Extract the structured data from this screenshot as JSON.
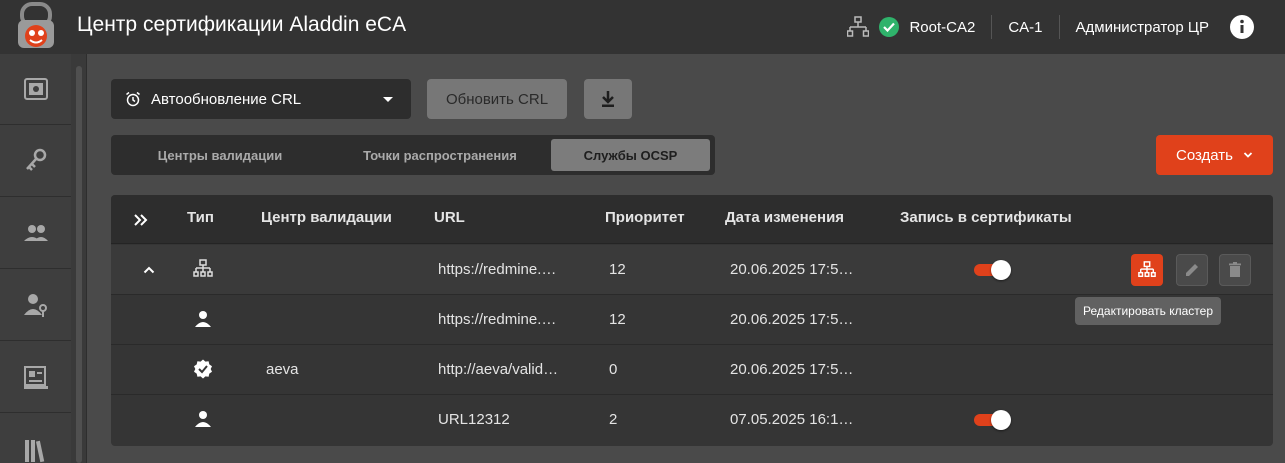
{
  "header": {
    "title": "Центр сертификации Aladdin eCA",
    "ca_name": "Root-CA2",
    "node": "CA-1",
    "user": "Администратор ЦР",
    "icons": [
      "logo-icon",
      "network-icon",
      "check-circle-icon",
      "info-icon"
    ]
  },
  "sidebar": {
    "items": [
      "dashboard-icon",
      "keys-icon",
      "users-icon",
      "user-key-icon",
      "certificate-icon",
      "library-icon"
    ]
  },
  "toolbar": {
    "select_label": "Автообновление CRL",
    "refresh_label": "Обновить CRL",
    "download_icon": "download-icon"
  },
  "tabs": [
    {
      "label": "Центры валидации",
      "active": false
    },
    {
      "label": "Точки распространения",
      "active": false
    },
    {
      "label": "Службы OCSP",
      "active": true
    }
  ],
  "create_label": "Создать",
  "table": {
    "columns": [
      "Тип",
      "Центр валидации",
      "URL",
      "Приоритет",
      "Дата изменения",
      "Запись в сертификаты"
    ],
    "rows": [
      {
        "type_icon": "cluster-icon",
        "center": "",
        "url": "https://redmine.…",
        "priority": "12",
        "date": "20.06.2025 17:5…",
        "write": true,
        "expanded": true
      },
      {
        "type_icon": "user-icon",
        "center": "",
        "url": "https://redmine.…",
        "priority": "12",
        "date": "20.06.2025 17:5…",
        "write": null
      },
      {
        "type_icon": "verified-icon",
        "center": "aeva",
        "url": "http://aeva/valid…",
        "priority": "0",
        "date": "20.06.2025 17:5…",
        "write": null
      },
      {
        "type_icon": "user-icon",
        "center": "",
        "url": "URL12312",
        "priority": "2",
        "date": "07.05.2025 16:1…",
        "write": true
      }
    ]
  },
  "tooltip": "Редактировать кластер",
  "colors": {
    "accent": "#e0411b",
    "header_bg": "#333333",
    "page_bg": "#4a4a4a",
    "table_bg": "#353535"
  }
}
